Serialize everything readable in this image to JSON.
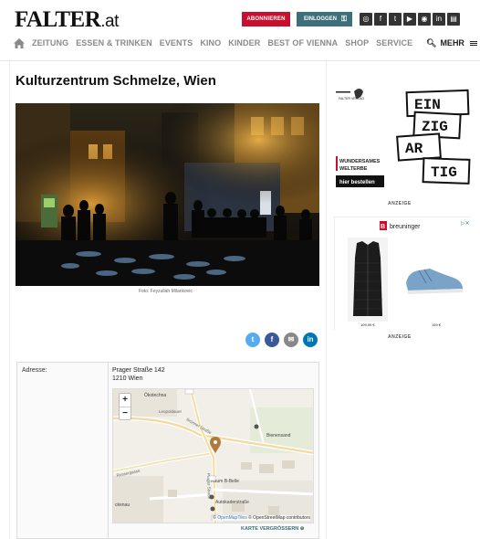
{
  "header": {
    "logo_main": "FALTER",
    "logo_tld": ".at",
    "subscribe_label": "ABONNIEREN",
    "login_label": "EINLOGGEN"
  },
  "socials": [
    "instagram-alt",
    "facebook",
    "twitter",
    "youtube",
    "instagram",
    "linkedin",
    "newsletter"
  ],
  "nav": {
    "items": [
      "ZEITUNG",
      "ESSEN & TRINKEN",
      "EVENTS",
      "KINO",
      "KINDER",
      "BEST OF VIENNA",
      "SHOP",
      "SERVICE"
    ],
    "more_label": "MEHR"
  },
  "article": {
    "title": "Kulturzentrum Schmelze, Wien",
    "photo_caption": "Foto: Feyzullah Milankovic"
  },
  "share": [
    "twitter",
    "facebook",
    "email",
    "linkedin"
  ],
  "info": {
    "address_label": "Adresse:",
    "street": "Prager Straße 142",
    "city": "1210 Wien",
    "map": {
      "labels": [
        "Ökotechna",
        "Leopoldauer",
        "Brünner Straße",
        "Bienensand",
        "Prager Straße",
        "Raum B-Belle",
        "Autokaderstraße",
        "Rossergasse",
        "ckenau"
      ],
      "attribution_prefix": "©",
      "attribution_link": "OpenMapTiles",
      "attribution_suffix": "© OpenStreetMap contributors",
      "enlarge_label": "KARTE VERGRÖSSERN"
    }
  },
  "sidebar": {
    "ad1": {
      "logo_text": "FALTER VERLAG",
      "headline_words": [
        "EIN",
        "ZIG",
        "AR",
        "TIG"
      ],
      "subline_1": "WUNDERSAMES",
      "subline_2": "WELTERBE",
      "cta": "hier bestellen",
      "label": "ANZEIGE"
    },
    "ad2": {
      "brand": "breuninger",
      "price_1": "109,99 €",
      "price_2": "159 €",
      "label": "ANZEIGE"
    }
  },
  "colors": {
    "accent_red": "#c8102e",
    "login_teal": "#3d6f7a",
    "nav_gray": "#8a8a8a"
  }
}
